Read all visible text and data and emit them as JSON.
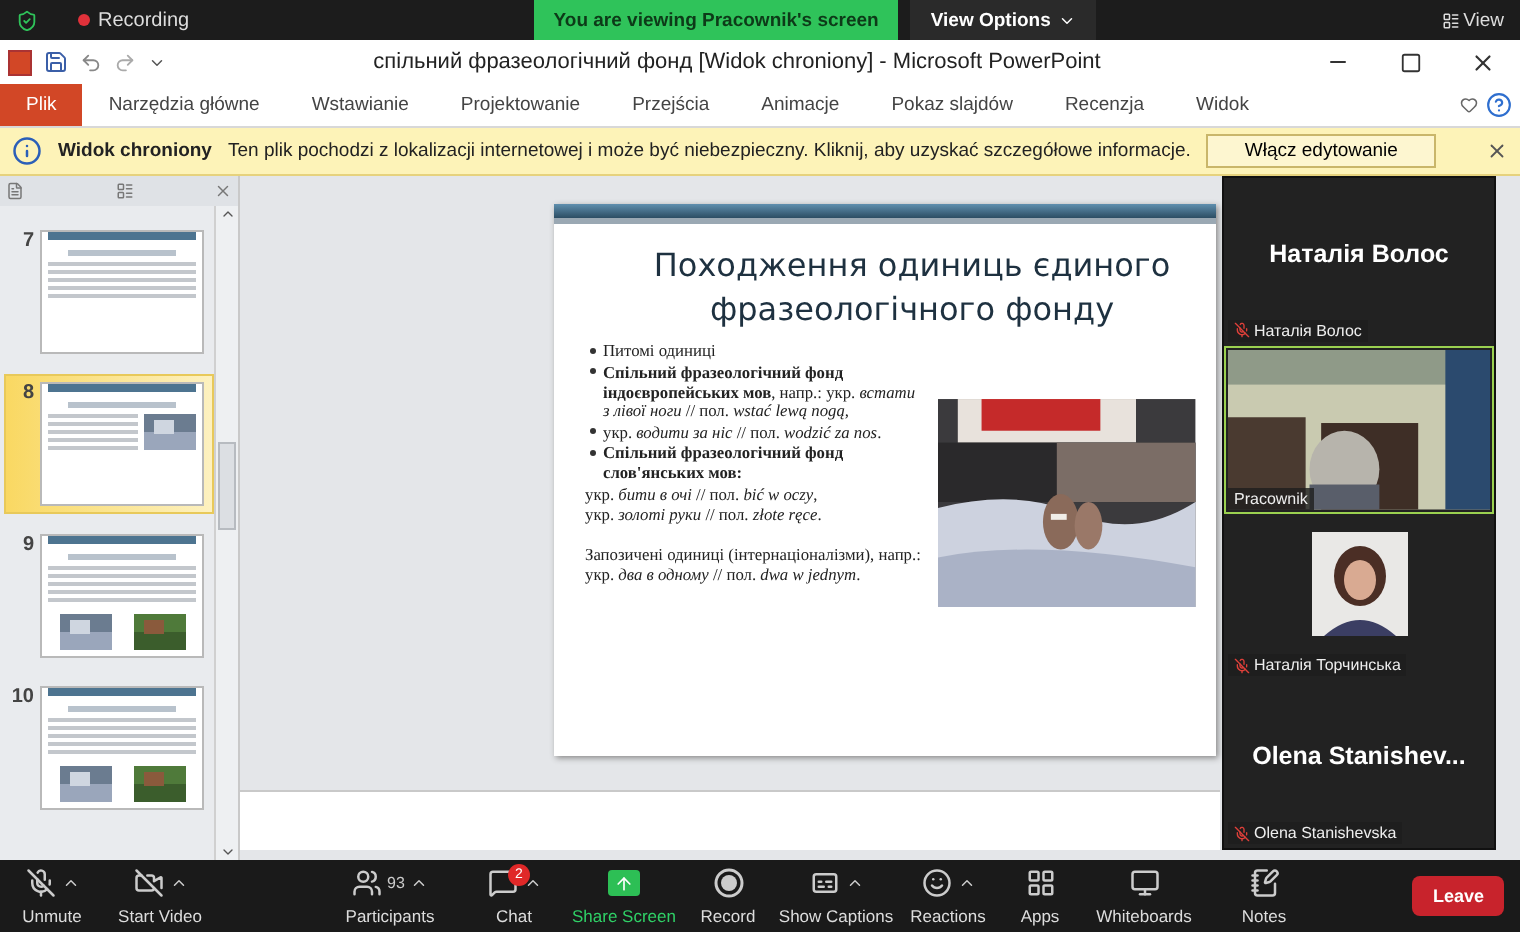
{
  "zoom_bar": {
    "recording": "Recording",
    "banner": "You are viewing Pracownik's screen",
    "view_options": "View Options",
    "view": "View"
  },
  "window": {
    "title": "спільний фразеологічний фонд [Widok chroniony]  -  Microsoft PowerPoint"
  },
  "ribbon_tabs": [
    {
      "label": "Plik",
      "selected": true
    },
    {
      "label": "Narzędzia główne",
      "selected": false
    },
    {
      "label": "Wstawianie",
      "selected": false
    },
    {
      "label": "Projektowanie",
      "selected": false
    },
    {
      "label": "Przejścia",
      "selected": false
    },
    {
      "label": "Animacje",
      "selected": false
    },
    {
      "label": "Pokaz slajdów",
      "selected": false
    },
    {
      "label": "Recenzja",
      "selected": false
    },
    {
      "label": "Widok",
      "selected": false
    }
  ],
  "protected_bar": {
    "title": "Widok chroniony",
    "message": "Ten plik pochodzi z lokalizacji internetowej i może być niebezpieczny. Kliknij, aby uzyskać szczegółowe informacje.",
    "button": "Włącz edytowanie"
  },
  "thumbnails": [
    {
      "number": "7",
      "selected": false,
      "kind": "text"
    },
    {
      "number": "8",
      "selected": true,
      "kind": "side-picture"
    },
    {
      "number": "9",
      "selected": false,
      "kind": "pictures-below"
    },
    {
      "number": "10",
      "selected": false,
      "kind": "pictures-below"
    }
  ],
  "slide": {
    "title": "Походження одиниць єдиного фразеологічного фонду",
    "lines": [
      {
        "kind": "bullet",
        "text": "Питомі одиниці"
      },
      {
        "kind": "bullet",
        "text": "**Спільний фразеологічний фонд індоєвропейських мов**, напр.: укр. *встати з лівої ноги* // пол. *wstać lewą nogą,*"
      },
      {
        "kind": "bullet",
        "text": "укр. *водити за ніс* // пол. *wodzić za nos*."
      },
      {
        "kind": "bullet",
        "text": "**Спільний фразеологічний фонд слов'янських мов:**"
      },
      {
        "kind": "plain",
        "text": "укр. *бити в очі* // пол. *bić w oczy*,"
      },
      {
        "kind": "plain",
        "text": "укр. *золоті руки* // пол. *złote ręce*."
      },
      {
        "kind": "gap",
        "text": "Запозичені одиниці (інтернаціоналізми), напр.: укр. *два в одному* // пол. *dwa w jednym*."
      }
    ]
  },
  "participants": [
    {
      "kind": "name",
      "display": "Наталія Волос",
      "label": "Наталія Волос",
      "muted": true,
      "active": false
    },
    {
      "kind": "video",
      "label": "Pracownik",
      "muted": false,
      "active": true
    },
    {
      "label": "Наталія Торчинська",
      "muted": true,
      "active": false
    },
    {
      "kind": "name",
      "display": "Olena  Stanishev...",
      "label": "Olena Stanishevska",
      "muted": true,
      "active": false
    }
  ],
  "toolbar": [
    {
      "kind": "mic",
      "label": "Unmute",
      "caret": true
    },
    {
      "kind": "video",
      "label": "Start Video",
      "caret": true
    },
    {
      "kind": "participants",
      "label": "Participants",
      "count": "93",
      "caret": true
    },
    {
      "kind": "chat",
      "label": "Chat",
      "badge": "2",
      "caret": true
    },
    {
      "kind": "share",
      "label": "Share Screen",
      "caret": false
    },
    {
      "kind": "record",
      "label": "Record",
      "caret": false
    },
    {
      "kind": "captions",
      "label": "Show Captions",
      "caret": true
    },
    {
      "kind": "reactions",
      "label": "Reactions",
      "caret": true
    },
    {
      "kind": "apps",
      "label": "Apps",
      "caret": false
    },
    {
      "kind": "whiteboards",
      "label": "Whiteboards",
      "caret": false
    },
    {
      "kind": "notes",
      "label": "Notes",
      "caret": false
    }
  ],
  "leave": "Leave"
}
